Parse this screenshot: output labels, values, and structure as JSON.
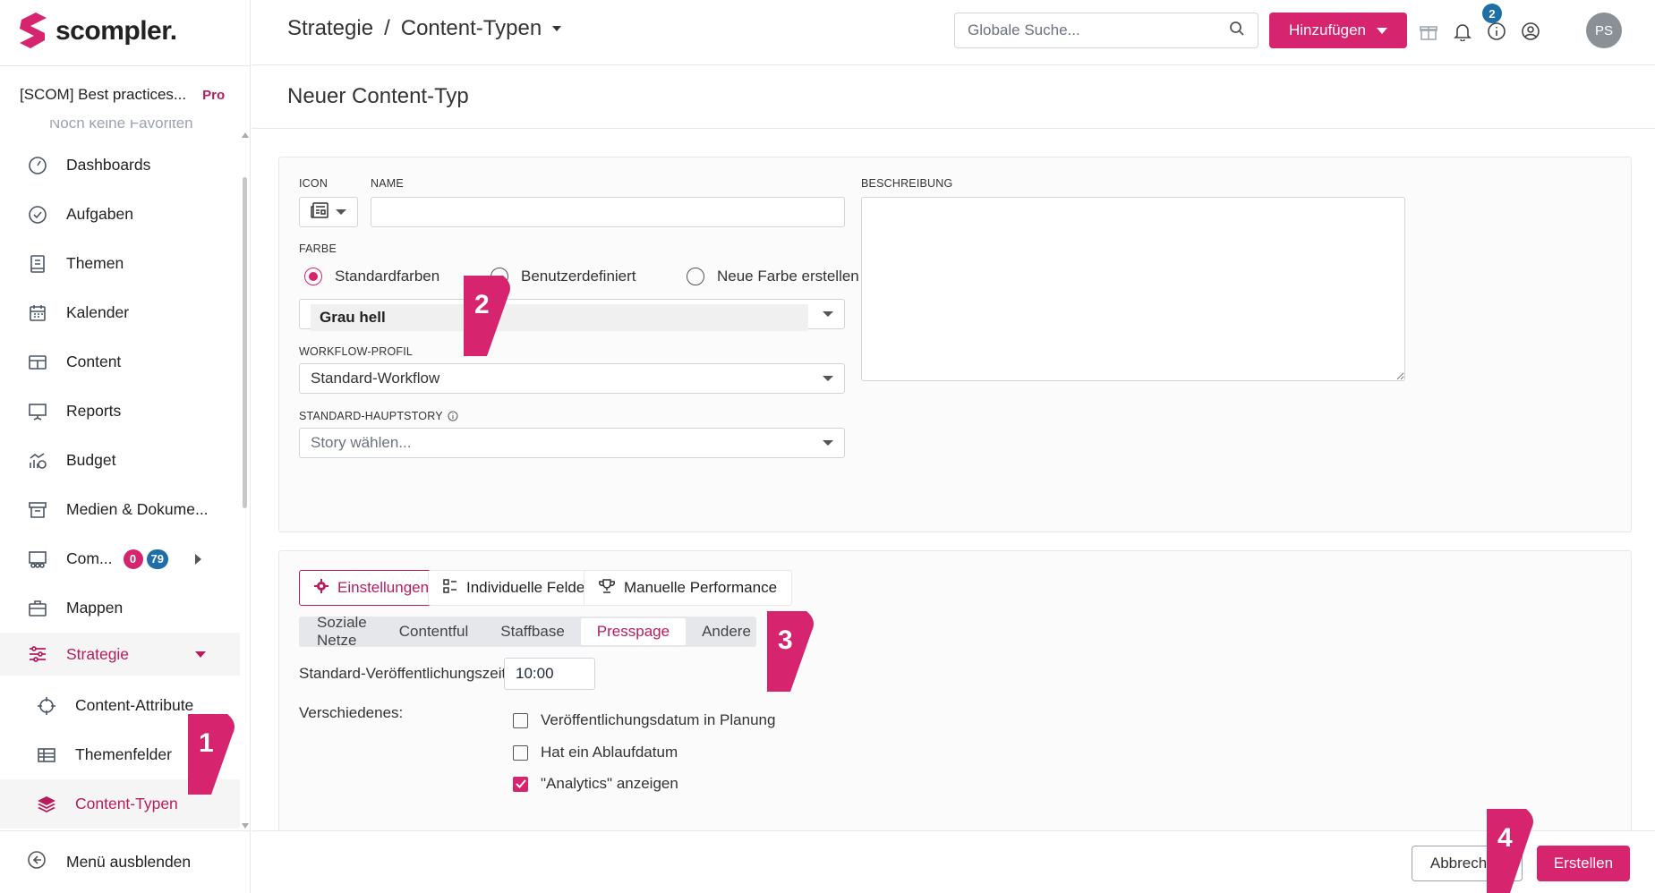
{
  "app": {
    "logo_text": "scompler."
  },
  "workspace": {
    "name": "[SCOM] Best practices...",
    "plan": "Pro"
  },
  "sidebar": {
    "cutoff_text": "Noch keine Favoriten",
    "items": [
      {
        "label": "Dashboards",
        "icon": "gauge-icon"
      },
      {
        "label": "Aufgaben",
        "icon": "check-circle-icon"
      },
      {
        "label": "Themen",
        "icon": "notebook-icon"
      },
      {
        "label": "Kalender",
        "icon": "calendar-icon"
      },
      {
        "label": "Content",
        "icon": "table-icon"
      },
      {
        "label": "Reports",
        "icon": "presentation-icon"
      },
      {
        "label": "Budget",
        "icon": "chart-coins-icon"
      },
      {
        "label": "Medien & Dokume...",
        "icon": "archive-icon"
      },
      {
        "label": "Com...",
        "icon": "community-icon",
        "badge_red": "0",
        "badge_blue": "79"
      },
      {
        "label": "Mappen",
        "icon": "briefcase-icon"
      },
      {
        "label": "Strategie",
        "icon": "sliders-icon"
      },
      {
        "label": "Content-Attribute",
        "icon": "crosshair-icon"
      },
      {
        "label": "Themenfelder",
        "icon": "grid-table-icon"
      },
      {
        "label": "Content-Typen",
        "icon": "layers-icon"
      }
    ],
    "hide_menu": "Menü ausblenden"
  },
  "header": {
    "breadcrumb_parent": "Strategie",
    "breadcrumb_sep": "/",
    "breadcrumb_current": "Content-Typen",
    "search_placeholder": "Globale Suche...",
    "add_label": "Hinzufügen",
    "notification_count": "2",
    "avatar_initials": "PS"
  },
  "page": {
    "title": "Neuer Content-Typ"
  },
  "form": {
    "icon_label": "ICON",
    "name_label": "NAME",
    "name_value": "",
    "description_label": "BESCHREIBUNG",
    "color_label": "FARBE",
    "color_options": [
      "Standardfarben",
      "Benutzerdefiniert",
      "Neue Farbe erstellen"
    ],
    "color_selected": "Grau hell",
    "workflow_label": "WORKFLOW-PROFIL",
    "workflow_value": "Standard-Workflow",
    "story_label": "STANDARD-HAUPTSTORY",
    "story_placeholder": "Story wählen..."
  },
  "settings": {
    "tabs": [
      "Einstellungen",
      "Individuelle Felder",
      "Manuelle Performance"
    ],
    "subtabs": [
      "Soziale Netze",
      "Contentful",
      "Staffbase",
      "Presspage",
      "Andere"
    ],
    "publish_time_label": "Standard-Veröffentlichungszeit:",
    "publish_time_value": "10:00",
    "misc_label": "Verschiedenes:",
    "checkboxes": [
      {
        "label": "Veröffentlichungsdatum in Planung",
        "checked": false
      },
      {
        "label": "Hat ein Ablaufdatum",
        "checked": false
      },
      {
        "label": "\"Analytics\" anzeigen",
        "checked": true
      }
    ]
  },
  "footer": {
    "cancel_label": "Abbrechen",
    "create_label": "Erstellen"
  },
  "annotations": [
    "1",
    "2",
    "3",
    "4"
  ],
  "colors": {
    "brand": "#d6246e",
    "brand_dark": "#b91c5c",
    "badge_blue": "#1e6fa8"
  }
}
